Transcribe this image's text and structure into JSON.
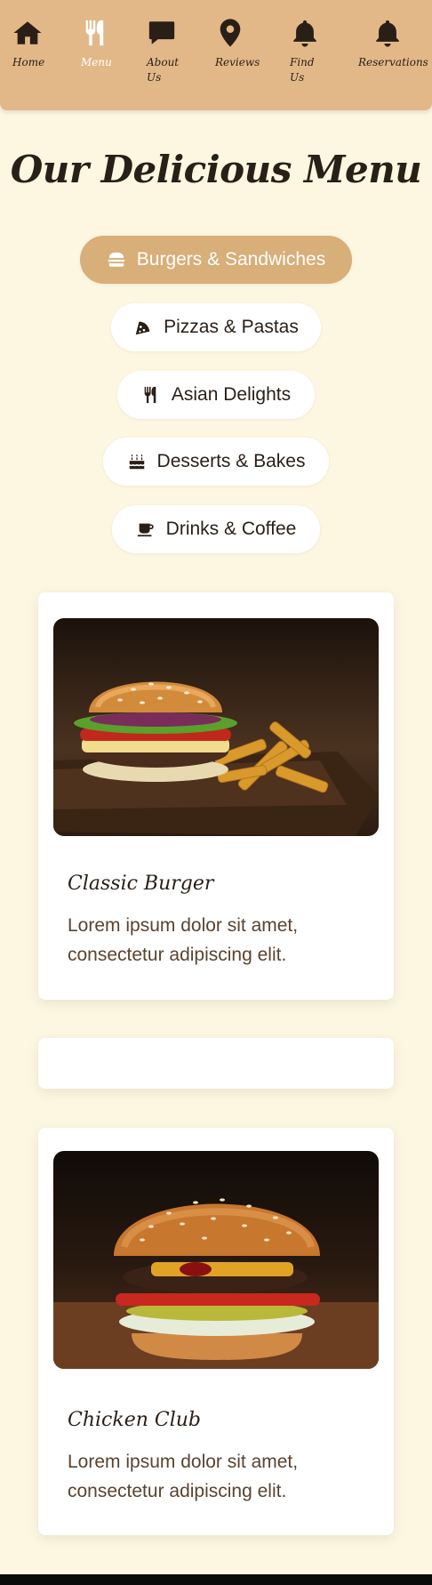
{
  "nav": {
    "items": [
      {
        "label": "Home",
        "icon": "home-icon"
      },
      {
        "label": "Menu",
        "icon": "utensils-icon",
        "active": true
      },
      {
        "label": "About Us",
        "icon": "comment-icon"
      },
      {
        "label": "Reviews",
        "icon": "map-pin-icon"
      },
      {
        "label": "Find Us",
        "icon": "bell-icon"
      },
      {
        "label": "Reservations",
        "icon": "bell-icon"
      }
    ]
  },
  "page": {
    "title": "Our Delicious Menu"
  },
  "categories": [
    {
      "label": "Burgers & Sandwiches",
      "icon": "hamburger-icon",
      "active": true
    },
    {
      "label": "Pizzas & Pastas",
      "icon": "pizza-icon"
    },
    {
      "label": "Asian Delights",
      "icon": "utensils-icon"
    },
    {
      "label": "Desserts & Bakes",
      "icon": "cake-icon"
    },
    {
      "label": "Drinks & Coffee",
      "icon": "coffee-icon"
    }
  ],
  "menu_items": [
    {
      "name": "Classic Burger",
      "description": "Lorem ipsum dolor sit amet, consectetur adipiscing elit.",
      "image": "burger-with-fries-photo"
    },
    {
      "name": "Chicken Club",
      "description": "Lorem ipsum dolor sit amet, consectetur adipiscing elit.",
      "image": "loaded-burger-photo"
    }
  ],
  "colors": {
    "background": "#fdf6e0",
    "nav": "#e2b888",
    "accent": "#d8ae79",
    "text": "#2a1f17"
  }
}
